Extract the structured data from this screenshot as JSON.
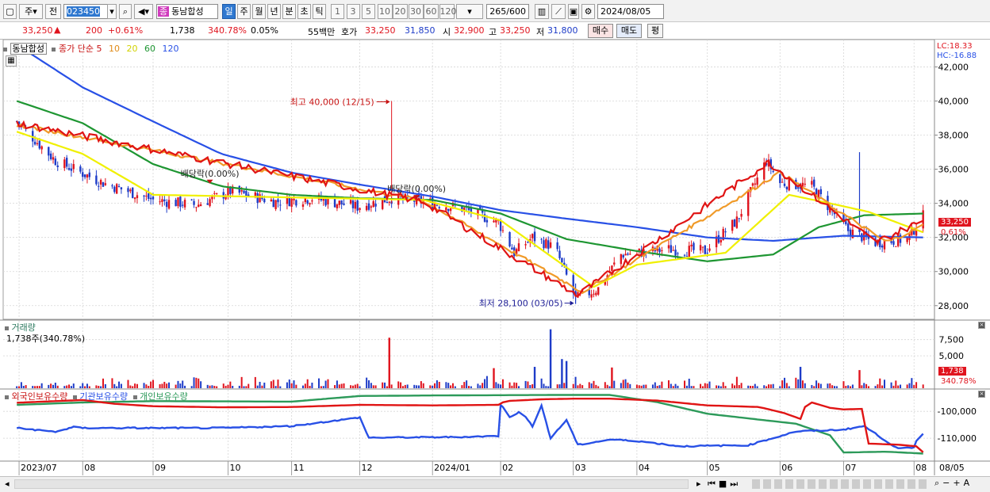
{
  "toolbar": {
    "period_prefix": "주",
    "jeon": "전",
    "code": "023450",
    "name": "동남합성",
    "name_badge": "종",
    "periods": [
      "일",
      "주",
      "월",
      "년",
      "분",
      "초",
      "틱"
    ],
    "intervals": [
      "1",
      "3",
      "5",
      "10",
      "20",
      "30",
      "60",
      "120"
    ],
    "count": "265",
    "count_total": "/600",
    "date": "2024/08/05"
  },
  "quote": {
    "price": "33,250",
    "change": "200",
    "rate": "+0.61%",
    "volume": "1,738",
    "vol_ratio": "340.78%",
    "turnover": "0.05%",
    "amount": "55백만",
    "hoga_label": "호가",
    "ask": "33,250",
    "bid": "31,850",
    "open_label": "시",
    "open": "32,900",
    "high_label": "고",
    "high": "33,250",
    "low_label": "저",
    "low": "31,800",
    "buy": "매수",
    "sell": "매도",
    "avg": "평"
  },
  "legend": {
    "main_title": "동남합성",
    "ma_label": "종가 단순 5",
    "ma10": "10",
    "ma20": "20",
    "ma60": "60",
    "ma120": "120",
    "vol_title": "거래량",
    "vol_value": "1,738주(340.78%)",
    "holders": [
      "외국인보유수량",
      "기관보유수량",
      "개인보유수량"
    ]
  },
  "right_tags": {
    "lc": "LC:18.33",
    "hc": "HC:-16.88",
    "price": "33,250",
    "rate": "0.61%",
    "vol": "1,738",
    "vol_rate": "340.78%"
  },
  "colors": {
    "up": "#e0141e",
    "down": "#1e3cc8",
    "ma5": "#e01414",
    "ma10": "#f09a28",
    "ma20": "#f0f000",
    "ma60": "#1e9632",
    "ma120": "#2850e6",
    "foreign": "#e01414",
    "inst": "#2850e6",
    "indiv": "#2d9a5a"
  },
  "chart_data": [
    {
      "type": "candlestick",
      "title": "동남합성",
      "ylim": [
        27200,
        43600
      ],
      "y_ticks": [
        42000,
        40000,
        38000,
        36000,
        34000,
        32000,
        30000,
        28000
      ],
      "y_tick_labels": [
        "42,000",
        "40,000",
        "38,000",
        "36,000",
        "34,000",
        "32,000",
        "30,000",
        "28,000"
      ],
      "x_labels": [
        "2023/07",
        "08",
        "09",
        "10",
        "11",
        "12",
        "2024/01",
        "02",
        "03",
        "04",
        "05",
        "06",
        "07",
        "08",
        "08/05"
      ],
      "x_label_dates": [
        "2023-07-04",
        "2023-08-01",
        "2023-09-01",
        "2023-10-04",
        "2023-11-01",
        "2023-12-01",
        "2024-01-02",
        "2024-02-01",
        "2024-03-04",
        "2024-04-01",
        "2024-05-02",
        "2024-06-03",
        "2024-07-01",
        "2024-08-01"
      ],
      "annotations": [
        {
          "text": "최고 40,000 (12/15)",
          "date": "2023-12-15",
          "value": 40000
        },
        {
          "text": "최저 28,100 (03/05)",
          "date": "2024-03-05",
          "value": 28100
        },
        {
          "text": "배당락(0.00%)",
          "date": "2023-09-26",
          "value": 35200
        },
        {
          "text": "배당락(0.00%)",
          "date": "2023-12-26",
          "value": 34300
        }
      ],
      "close_anchors": [
        [
          "2023-07-03",
          38800
        ],
        [
          "2023-07-20",
          36500
        ],
        [
          "2023-08-10",
          35200
        ],
        [
          "2023-09-01",
          34200
        ],
        [
          "2023-09-20",
          33900
        ],
        [
          "2023-10-05",
          34700
        ],
        [
          "2023-10-25",
          34100
        ],
        [
          "2023-11-10",
          34300
        ],
        [
          "2023-11-30",
          33800
        ],
        [
          "2023-12-15",
          34300
        ],
        [
          "2023-12-30",
          34100
        ],
        [
          "2024-01-15",
          33700
        ],
        [
          "2024-01-31",
          32900
        ],
        [
          "2024-02-07",
          31100
        ],
        [
          "2024-02-15",
          32000
        ],
        [
          "2024-02-25",
          31400
        ],
        [
          "2024-03-05",
          28400
        ],
        [
          "2024-03-15",
          29000
        ],
        [
          "2024-03-25",
          31000
        ],
        [
          "2024-04-15",
          31300
        ],
        [
          "2024-05-01",
          31200
        ],
        [
          "2024-05-15",
          33000
        ],
        [
          "2024-05-28",
          36500
        ],
        [
          "2024-06-03",
          35200
        ],
        [
          "2024-06-17",
          35000
        ],
        [
          "2024-07-03",
          32400
        ],
        [
          "2024-07-15",
          31700
        ],
        [
          "2024-07-29",
          31900
        ],
        [
          "2024-08-05",
          33250
        ]
      ],
      "series": [
        {
          "name": "5",
          "anchors": [
            [
              "2023-07-03",
              38700
            ],
            [
              "2023-12-29",
              34100
            ],
            [
              "2024-03-06",
              28600
            ],
            [
              "2024-05-29",
              36400
            ],
            [
              "2024-07-15",
              31700
            ],
            [
              "2024-08-05",
              33000
            ]
          ]
        },
        {
          "name": "10",
          "anchors": [
            [
              "2023-07-03",
              38600
            ],
            [
              "2023-12-29",
              34150
            ],
            [
              "2024-03-08",
              28800
            ],
            [
              "2024-06-03",
              35800
            ],
            [
              "2024-07-20",
              31700
            ],
            [
              "2024-08-05",
              32700
            ]
          ]
        },
        {
          "name": "20",
          "anchors": [
            [
              "2023-07-03",
              38200
            ],
            [
              "2023-08-01",
              36900
            ],
            [
              "2023-09-01",
              34500
            ],
            [
              "2023-12-29",
              34200
            ],
            [
              "2024-02-01",
              33000
            ],
            [
              "2024-03-13",
              29100
            ],
            [
              "2024-04-01",
              30400
            ],
            [
              "2024-05-10",
              31100
            ],
            [
              "2024-06-07",
              34500
            ],
            [
              "2024-06-25",
              34000
            ],
            [
              "2024-07-12",
              33500
            ],
            [
              "2024-08-05",
              32300
            ]
          ]
        },
        {
          "name": "60",
          "anchors": [
            [
              "2023-07-03",
              40000
            ],
            [
              "2023-08-01",
              38700
            ],
            [
              "2023-09-01",
              36300
            ],
            [
              "2023-10-01",
              35000
            ],
            [
              "2023-11-01",
              34500
            ],
            [
              "2023-12-01",
              34300
            ],
            [
              "2024-01-02",
              34200
            ],
            [
              "2024-02-01",
              33400
            ],
            [
              "2024-03-01",
              31900
            ],
            [
              "2024-04-01",
              31200
            ],
            [
              "2024-05-02",
              30600
            ],
            [
              "2024-05-31",
              31000
            ],
            [
              "2024-06-20",
              32600
            ],
            [
              "2024-07-10",
              33300
            ],
            [
              "2024-08-05",
              33400
            ]
          ]
        },
        {
          "name": "120",
          "anchors": [
            [
              "2023-07-03",
              43300
            ],
            [
              "2023-08-01",
              40800
            ],
            [
              "2023-09-01",
              38800
            ],
            [
              "2023-10-01",
              36900
            ],
            [
              "2023-11-01",
              35800
            ],
            [
              "2023-12-01",
              35100
            ],
            [
              "2024-01-02",
              34400
            ],
            [
              "2024-02-01",
              33600
            ],
            [
              "2024-03-01",
              33100
            ],
            [
              "2024-04-01",
              32600
            ],
            [
              "2024-05-02",
              32000
            ],
            [
              "2024-05-31",
              31800
            ],
            [
              "2024-07-01",
              32100
            ],
            [
              "2024-08-05",
              32000
            ]
          ]
        }
      ]
    },
    {
      "type": "bar",
      "title": "거래량",
      "ylim": [
        0,
        10400
      ],
      "y_ticks": [
        7500,
        5000
      ],
      "y_tick_labels": [
        "7,500",
        "5,000"
      ],
      "spikes": [
        [
          "2023-12-14",
          7800,
          "up"
        ],
        [
          "2024-02-23",
          9100,
          "down"
        ],
        [
          "2024-02-28",
          4500,
          "down"
        ],
        [
          "2024-03-01",
          4200,
          "down"
        ],
        [
          "2024-02-16",
          3300,
          "down"
        ],
        [
          "2024-01-29",
          3100,
          "up"
        ],
        [
          "2024-03-21",
          3200,
          "up"
        ],
        [
          "2024-06-12",
          3300,
          "down"
        ],
        [
          "2024-07-08",
          2800,
          "up"
        ]
      ]
    },
    {
      "type": "line",
      "title": "보유수량",
      "ylim": [
        -118500,
        -92000
      ],
      "y_ticks": [
        -100000,
        -110000
      ],
      "y_tick_labels": [
        "-100,000",
        "-110,000"
      ],
      "series": [
        {
          "name": "외국인보유수량",
          "anchors": [
            [
              "2023-07-03",
              -96800
            ],
            [
              "2023-08-01",
              -95800
            ],
            [
              "2023-08-15",
              -97200
            ],
            [
              "2023-09-01",
              -98100
            ],
            [
              "2023-10-01",
              -98500
            ],
            [
              "2023-11-01",
              -98400
            ],
            [
              "2023-12-01",
              -97600
            ],
            [
              "2024-01-02",
              -97800
            ],
            [
              "2024-01-31",
              -97600
            ],
            [
              "2024-02-03",
              -96200
            ],
            [
              "2024-02-20",
              -95500
            ],
            [
              "2024-03-04",
              -95300
            ],
            [
              "2024-03-20",
              -95300
            ],
            [
              "2024-04-10",
              -96000
            ],
            [
              "2024-05-02",
              -97800
            ],
            [
              "2024-05-25",
              -98400
            ],
            [
              "2024-06-05",
              -100700
            ],
            [
              "2024-06-12",
              -102800
            ],
            [
              "2024-06-15",
              -96200
            ],
            [
              "2024-06-25",
              -98700
            ],
            [
              "2024-07-01",
              -99300
            ],
            [
              "2024-07-09",
              -99100
            ],
            [
              "2024-07-12",
              -112000
            ],
            [
              "2024-07-25",
              -112400
            ],
            [
              "2024-08-02",
              -113000
            ],
            [
              "2024-08-05",
              -115200
            ]
          ]
        },
        {
          "name": "기관보유수량",
          "anchors": [
            [
              "2023-07-03",
              -106200
            ],
            [
              "2023-07-20",
              -107600
            ],
            [
              "2023-07-28",
              -105900
            ],
            [
              "2023-08-01",
              -106200
            ],
            [
              "2023-09-01",
              -106200
            ],
            [
              "2023-10-01",
              -106200
            ],
            [
              "2023-11-01",
              -105500
            ],
            [
              "2023-12-01",
              -102300
            ],
            [
              "2023-12-05",
              -109800
            ],
            [
              "2023-12-20",
              -109700
            ],
            [
              "2024-01-10",
              -109600
            ],
            [
              "2024-01-31",
              -109200
            ],
            [
              "2024-02-01",
              -97500
            ],
            [
              "2024-02-05",
              -102000
            ],
            [
              "2024-02-10",
              -100000
            ],
            [
              "2024-02-15",
              -105500
            ],
            [
              "2024-02-19",
              -97800
            ],
            [
              "2024-02-23",
              -110100
            ],
            [
              "2024-03-01",
              -103200
            ],
            [
              "2024-03-06",
              -112500
            ],
            [
              "2024-03-20",
              -110500
            ],
            [
              "2024-04-01",
              -111000
            ],
            [
              "2024-04-20",
              -113000
            ],
            [
              "2024-05-20",
              -112600
            ],
            [
              "2024-06-03",
              -109200
            ],
            [
              "2024-06-10",
              -107500
            ],
            [
              "2024-07-01",
              -106800
            ],
            [
              "2024-07-10",
              -105500
            ],
            [
              "2024-07-20",
              -111200
            ],
            [
              "2024-07-25",
              -113900
            ],
            [
              "2024-08-01",
              -113500
            ],
            [
              "2024-08-03",
              -108100
            ],
            [
              "2024-08-05",
              -108200
            ]
          ]
        },
        {
          "name": "개인보유수량",
          "anchors": [
            [
              "2023-07-03",
              -97600
            ],
            [
              "2023-08-01",
              -96700
            ],
            [
              "2023-09-01",
              -96200
            ],
            [
              "2023-10-01",
              -96300
            ],
            [
              "2023-11-01",
              -96400
            ],
            [
              "2023-12-01",
              -94300
            ],
            [
              "2024-01-02",
              -94100
            ],
            [
              "2024-02-01",
              -94000
            ],
            [
              "2024-03-01",
              -93900
            ],
            [
              "2024-03-20",
              -93900
            ],
            [
              "2024-04-10",
              -96600
            ],
            [
              "2024-05-02",
              -100900
            ],
            [
              "2024-05-25",
              -103100
            ],
            [
              "2024-06-10",
              -104600
            ],
            [
              "2024-06-25",
              -108900
            ],
            [
              "2024-07-01",
              -115300
            ],
            [
              "2024-07-20",
              -115000
            ],
            [
              "2024-08-05",
              -115700
            ]
          ]
        }
      ]
    }
  ]
}
